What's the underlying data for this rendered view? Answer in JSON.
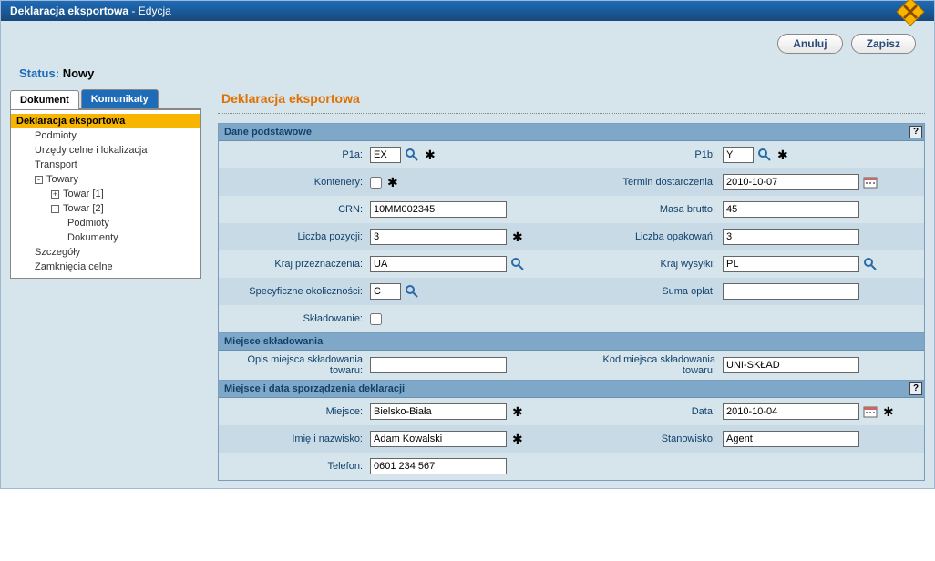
{
  "window": {
    "title": "Deklaracja eksportowa",
    "subtitle": "Edycja"
  },
  "toolbar": {
    "cancel": "Anuluj",
    "save": "Zapisz"
  },
  "status": {
    "label": "Status:",
    "value": "Nowy"
  },
  "tabs": {
    "dokument": "Dokument",
    "komunikaty": "Komunikaty"
  },
  "tree": {
    "root": "Deklaracja eksportowa",
    "podmioty": "Podmioty",
    "urzedy": "Urzędy celne i lokalizacja",
    "transport": "Transport",
    "towary": "Towary",
    "towar1": "Towar [1]",
    "towar2": "Towar [2]",
    "t2podmioty": "Podmioty",
    "t2dokumenty": "Dokumenty",
    "szczegoly": "Szczegóły",
    "zamkniecia": "Zamknięcia celne"
  },
  "page_title": "Deklaracja eksportowa",
  "sections": {
    "dane": "Dane podstawowe",
    "miejsce_skl": "Miejsce składowania",
    "miejsce_data": "Miejsce i data sporządzenia deklaracji"
  },
  "labels": {
    "p1a": "P1a:",
    "p1b": "P1b:",
    "kontenery": "Kontenery:",
    "termin": "Termin dostarczenia:",
    "crn": "CRN:",
    "masa": "Masa brutto:",
    "pozycji": "Liczba pozycji:",
    "opakowan": "Liczba opakowań:",
    "kraj_prz": "Kraj przeznaczenia:",
    "kraj_wys": "Kraj wysyłki:",
    "spec": "Specyficzne okoliczności:",
    "suma": "Suma opłat:",
    "sklad": "Składowanie:",
    "opis_towaru": "Opis miejsca składowania towaru:",
    "kod_towaru": "Kod miejsca składowania towaru:",
    "miejsce": "Miejsce:",
    "data": "Data:",
    "imie": "Imię i nazwisko:",
    "stanowisko": "Stanowisko:",
    "telefon": "Telefon:"
  },
  "values": {
    "p1a": "EX",
    "p1b": "Y",
    "termin": "2010-10-07",
    "crn": "10MM002345",
    "masa": "45",
    "pozycji": "3",
    "opakowan": "3",
    "kraj_prz": "UA",
    "kraj_wys": "PL",
    "spec": "C",
    "suma": "",
    "opis_towaru": "",
    "kod_towaru": "UNI-SKŁAD",
    "miejsce": "Bielsko-Biała",
    "data": "2010-10-04",
    "imie": "Adam Kowalski",
    "stanowisko": "Agent",
    "telefon": "0601 234 567"
  }
}
